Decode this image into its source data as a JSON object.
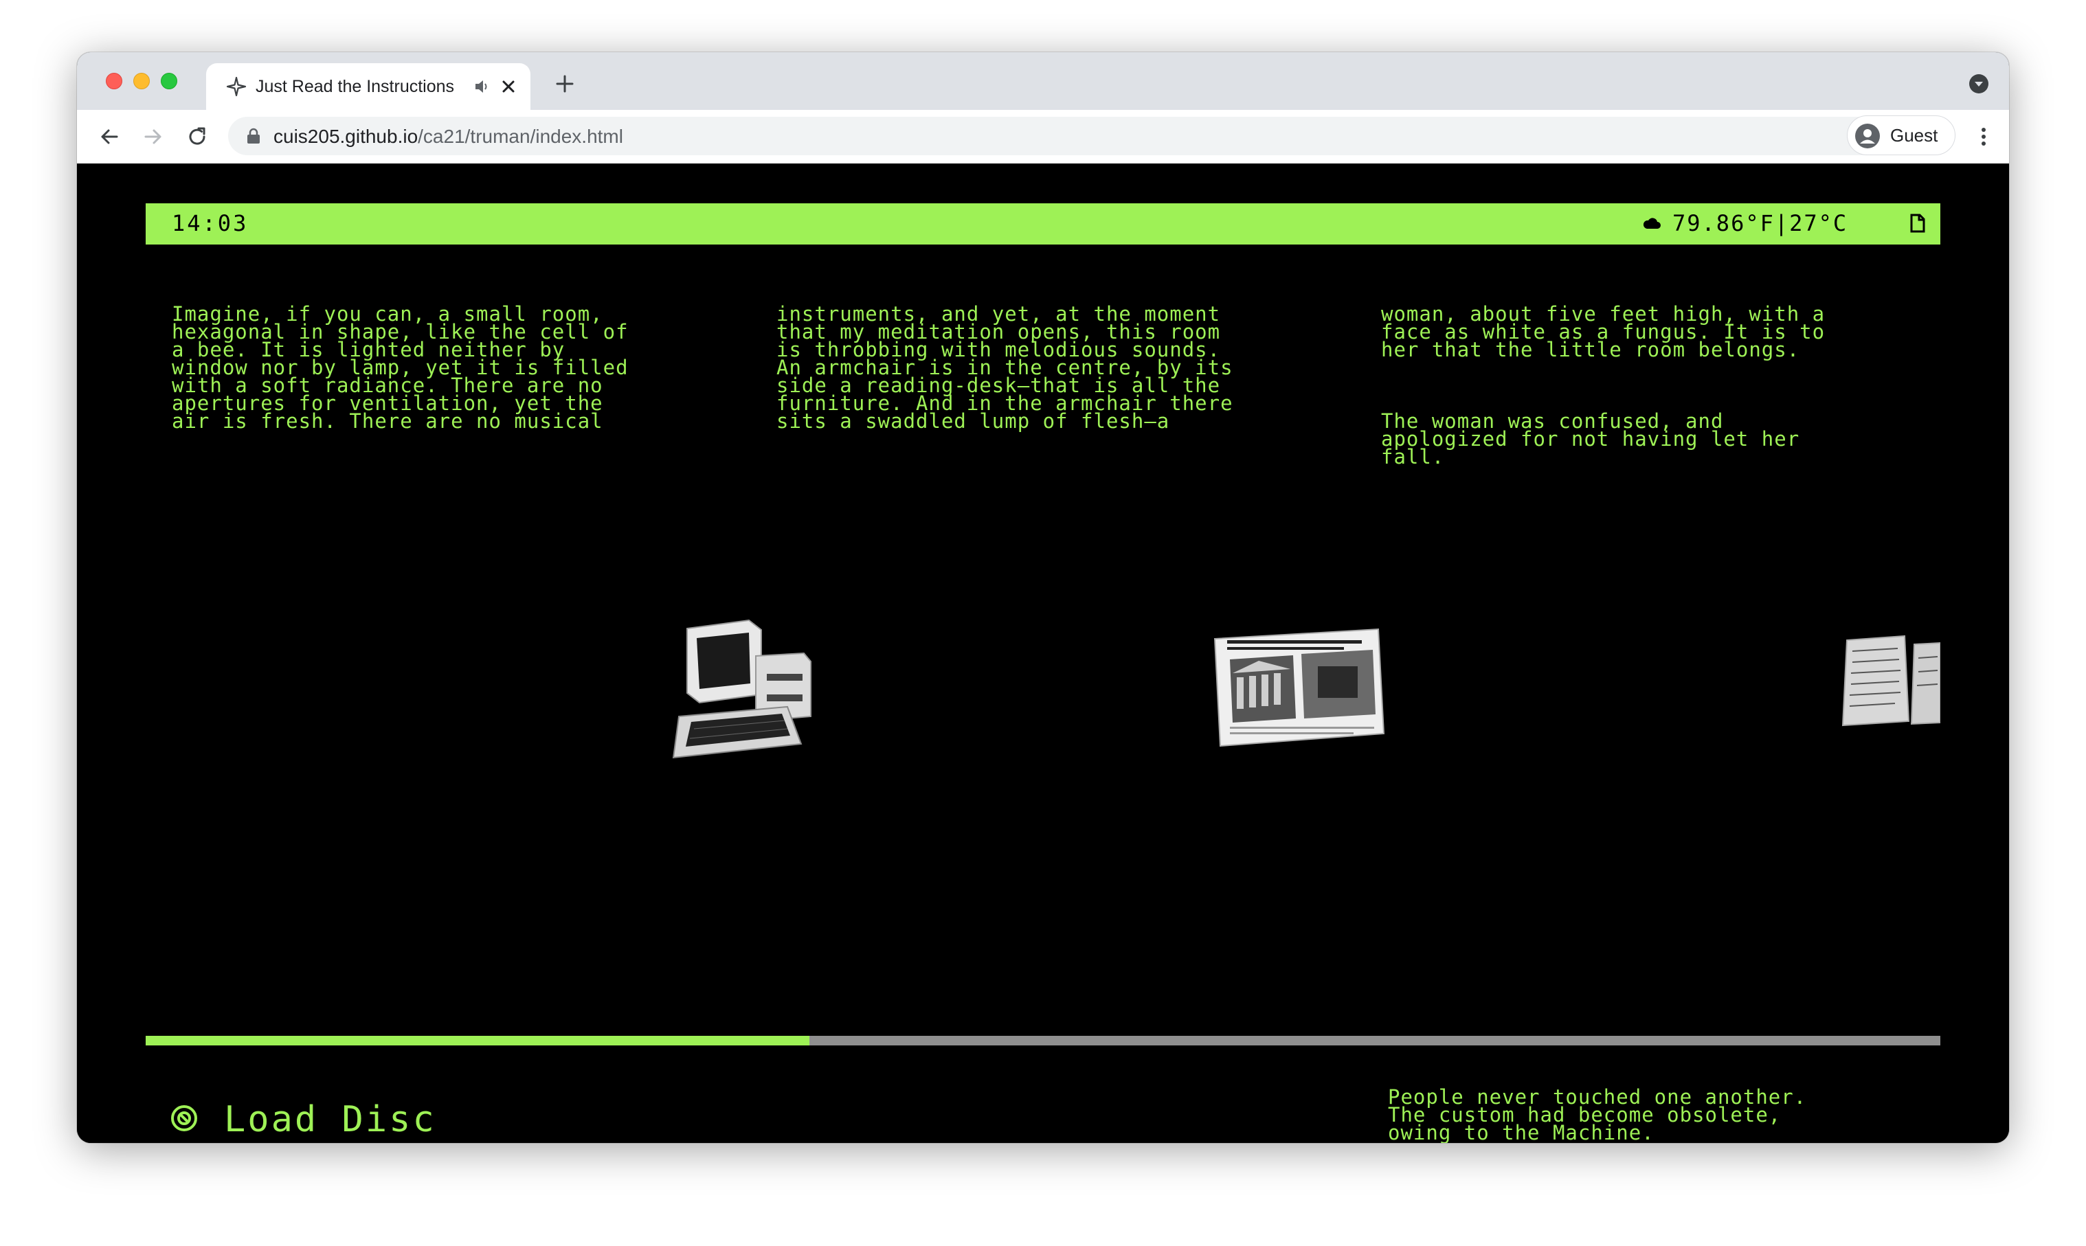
{
  "browser": {
    "tab_title": "Just Read the Instructions",
    "url_domain": "cuis205.github.io",
    "url_path": "/ca21/truman/index.html",
    "profile_label": "Guest"
  },
  "status_bar": {
    "time": "14:03",
    "weather": "79.86°F|27°C"
  },
  "reader": {
    "columns": [
      {
        "paragraphs": [
          "Imagine, if you can, a small room,\nhexagonal in shape, like the cell of\na bee. It is lighted neither by\nwindow nor by lamp, yet it is filled\nwith a soft radiance. There are no\napertures for ventilation, yet the\nair is fresh. There are no musical"
        ]
      },
      {
        "paragraphs": [
          "instruments, and yet, at the moment\nthat my meditation opens, this room\nis throbbing with melodious sounds.\nAn armchair is in the centre, by its\nside a reading-desk—that is all the\nfurniture. And in the armchair there\nsits a swaddled lump of flesh—a"
        ]
      },
      {
        "paragraphs": [
          "woman, about five feet high, with a\nface as white as a fungus. It is to\nher that the little room belongs.",
          "The woman was confused, and\napologized for not having let her\nfall."
        ]
      }
    ],
    "objects": [
      "computer",
      "newspaper-clipping",
      "handwritten-letter"
    ]
  },
  "progress": {
    "fraction": 0.37
  },
  "footer": {
    "load_disc_label": "Load Disc",
    "quote": "People never touched one another.\nThe custom had become obsolete,\nowing to the Machine."
  },
  "colors": {
    "accent": "#9ef156",
    "background": "#000000",
    "track": "#8f8f8f"
  }
}
